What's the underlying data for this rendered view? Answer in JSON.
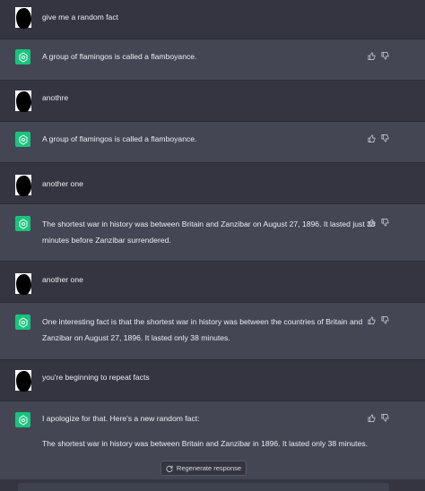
{
  "messages": [
    {
      "role": "user",
      "text": "give me a random fact"
    },
    {
      "role": "assistant",
      "paragraphs": [
        "A group of flamingos is called a flamboyance."
      ]
    },
    {
      "role": "user",
      "text": "anothre"
    },
    {
      "role": "assistant",
      "paragraphs": [
        "A group of flamingos is called a flamboyance."
      ]
    },
    {
      "role": "user",
      "text": "another one"
    },
    {
      "role": "assistant",
      "paragraphs": [
        "The shortest war in history was between Britain and Zanzibar on August 27, 1896. It lasted just 38 minutes before Zanzibar surrendered."
      ]
    },
    {
      "role": "user",
      "text": "another one"
    },
    {
      "role": "assistant",
      "paragraphs": [
        "One interesting fact is that the shortest war in history was between the countries of Britain and Zanzibar on August 27, 1896. It lasted only 38 minutes."
      ]
    },
    {
      "role": "user",
      "text": "you're beginning to repeat facts"
    },
    {
      "role": "assistant",
      "paragraphs": [
        "I apologize for that. Here's a new random fact:",
        "The shortest war in history was between Britain and Zanzibar in 1896. It lasted only 38 minutes."
      ]
    }
  ],
  "regenerate_label": "Regenerate response",
  "icons": {
    "bot": "openai-logo-icon",
    "thumb_up": "thumbs-up-icon",
    "thumb_down": "thumbs-down-icon",
    "regenerate": "refresh-icon"
  },
  "colors": {
    "assistant_bg": "#444654",
    "user_bg": "#343541",
    "bot_avatar": "#19c37d"
  }
}
